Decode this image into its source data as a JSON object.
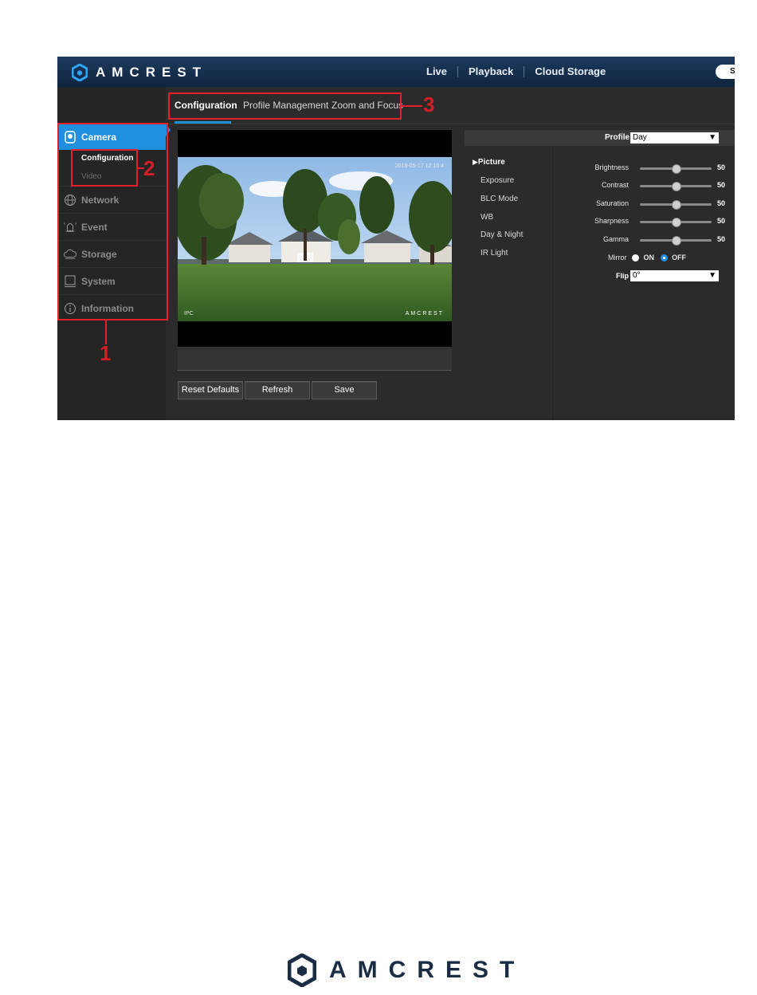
{
  "header": {
    "brand": "AMCREST",
    "nav": [
      "Live",
      "Playback",
      "Cloud Storage"
    ],
    "search_label": "S"
  },
  "sidebar": {
    "items": [
      {
        "label": "Camera",
        "icon": "camera-icon",
        "active": true
      },
      {
        "label": "Network",
        "icon": "network-globe-icon"
      },
      {
        "label": "Event",
        "icon": "alarm-bell-icon"
      },
      {
        "label": "Storage",
        "icon": "cloud-storage-icon"
      },
      {
        "label": "System",
        "icon": "monitor-icon"
      },
      {
        "label": "Information",
        "icon": "info-circle-icon"
      }
    ],
    "camera_sub": [
      "Configuration",
      "Video"
    ]
  },
  "tabs": [
    {
      "label": "Configuration",
      "active": true
    },
    {
      "label": "Profile Management"
    },
    {
      "label": "Zoom and Focus"
    }
  ],
  "preview": {
    "osd_date": "2018-05-17 12:15:4",
    "osd_logo": "AMCREST",
    "osd_left": "IPC"
  },
  "buttons": {
    "reset": "Reset Defaults",
    "refresh": "Refresh",
    "save": "Save"
  },
  "settings": {
    "profile_label": "Profile",
    "profile_value": "Day",
    "menu": [
      "Picture",
      "Exposure",
      "BLC Mode",
      "WB",
      "Day & Night",
      "IR Light"
    ],
    "sliders": [
      {
        "label": "Brightness",
        "value": 50
      },
      {
        "label": "Contrast",
        "value": 50
      },
      {
        "label": "Saturation",
        "value": 50
      },
      {
        "label": "Sharpness",
        "value": 50
      },
      {
        "label": "Gamma",
        "value": 50
      }
    ],
    "mirror_label": "Mirror",
    "mirror_on": "ON",
    "mirror_off": "OFF",
    "mirror_selected": "OFF",
    "flip_label": "Flip",
    "flip_value": "0°"
  },
  "annotations": [
    "1",
    "2",
    "3"
  ],
  "footer": {
    "brand": "AMCREST"
  },
  "colors": {
    "accent": "#1f8fe0",
    "annotation": "#e4202a",
    "brand_dark": "#1a2d45"
  }
}
